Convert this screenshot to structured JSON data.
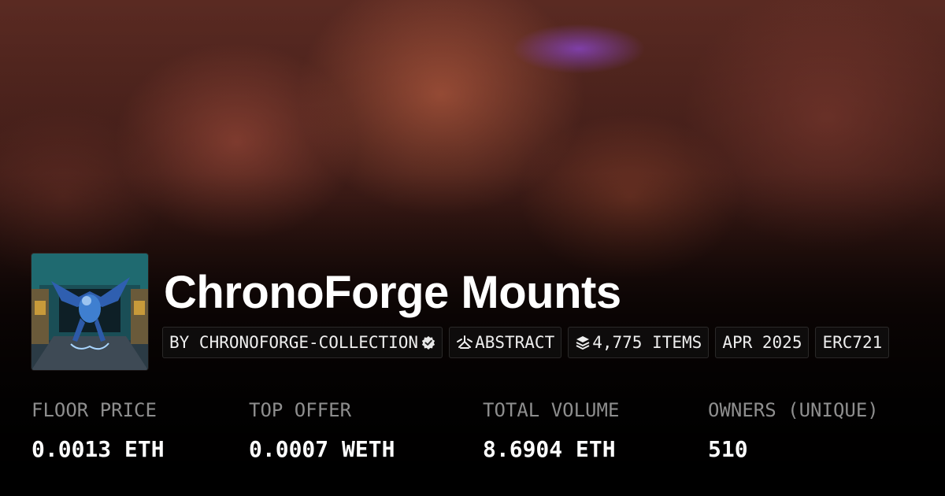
{
  "collection": {
    "name": "ChronoForge Mounts",
    "creator": "BY CHRONOFORGE-COLLECTION",
    "verified_icon": "verified-badge-icon",
    "chain": "ABSTRACT",
    "chain_icon": "abstract-chain-icon",
    "items": "4,775 ITEMS",
    "items_icon": "layers-icon",
    "created": "APR 2025",
    "standard": "ERC721"
  },
  "stats": [
    {
      "label": "FLOOR PRICE",
      "value": "0.0013 ETH"
    },
    {
      "label": "TOP OFFER",
      "value": "0.0007 WETH"
    },
    {
      "label": "TOTAL VOLUME",
      "value": "8.6904 ETH"
    },
    {
      "label": "OWNERS (UNIQUE)",
      "value": "510"
    }
  ],
  "colors": {
    "background": "#000000",
    "label": "#8e8e8e",
    "value": "#ffffff",
    "banner_tint": "#5a2a22",
    "accent_purple": "#8c46c8"
  }
}
